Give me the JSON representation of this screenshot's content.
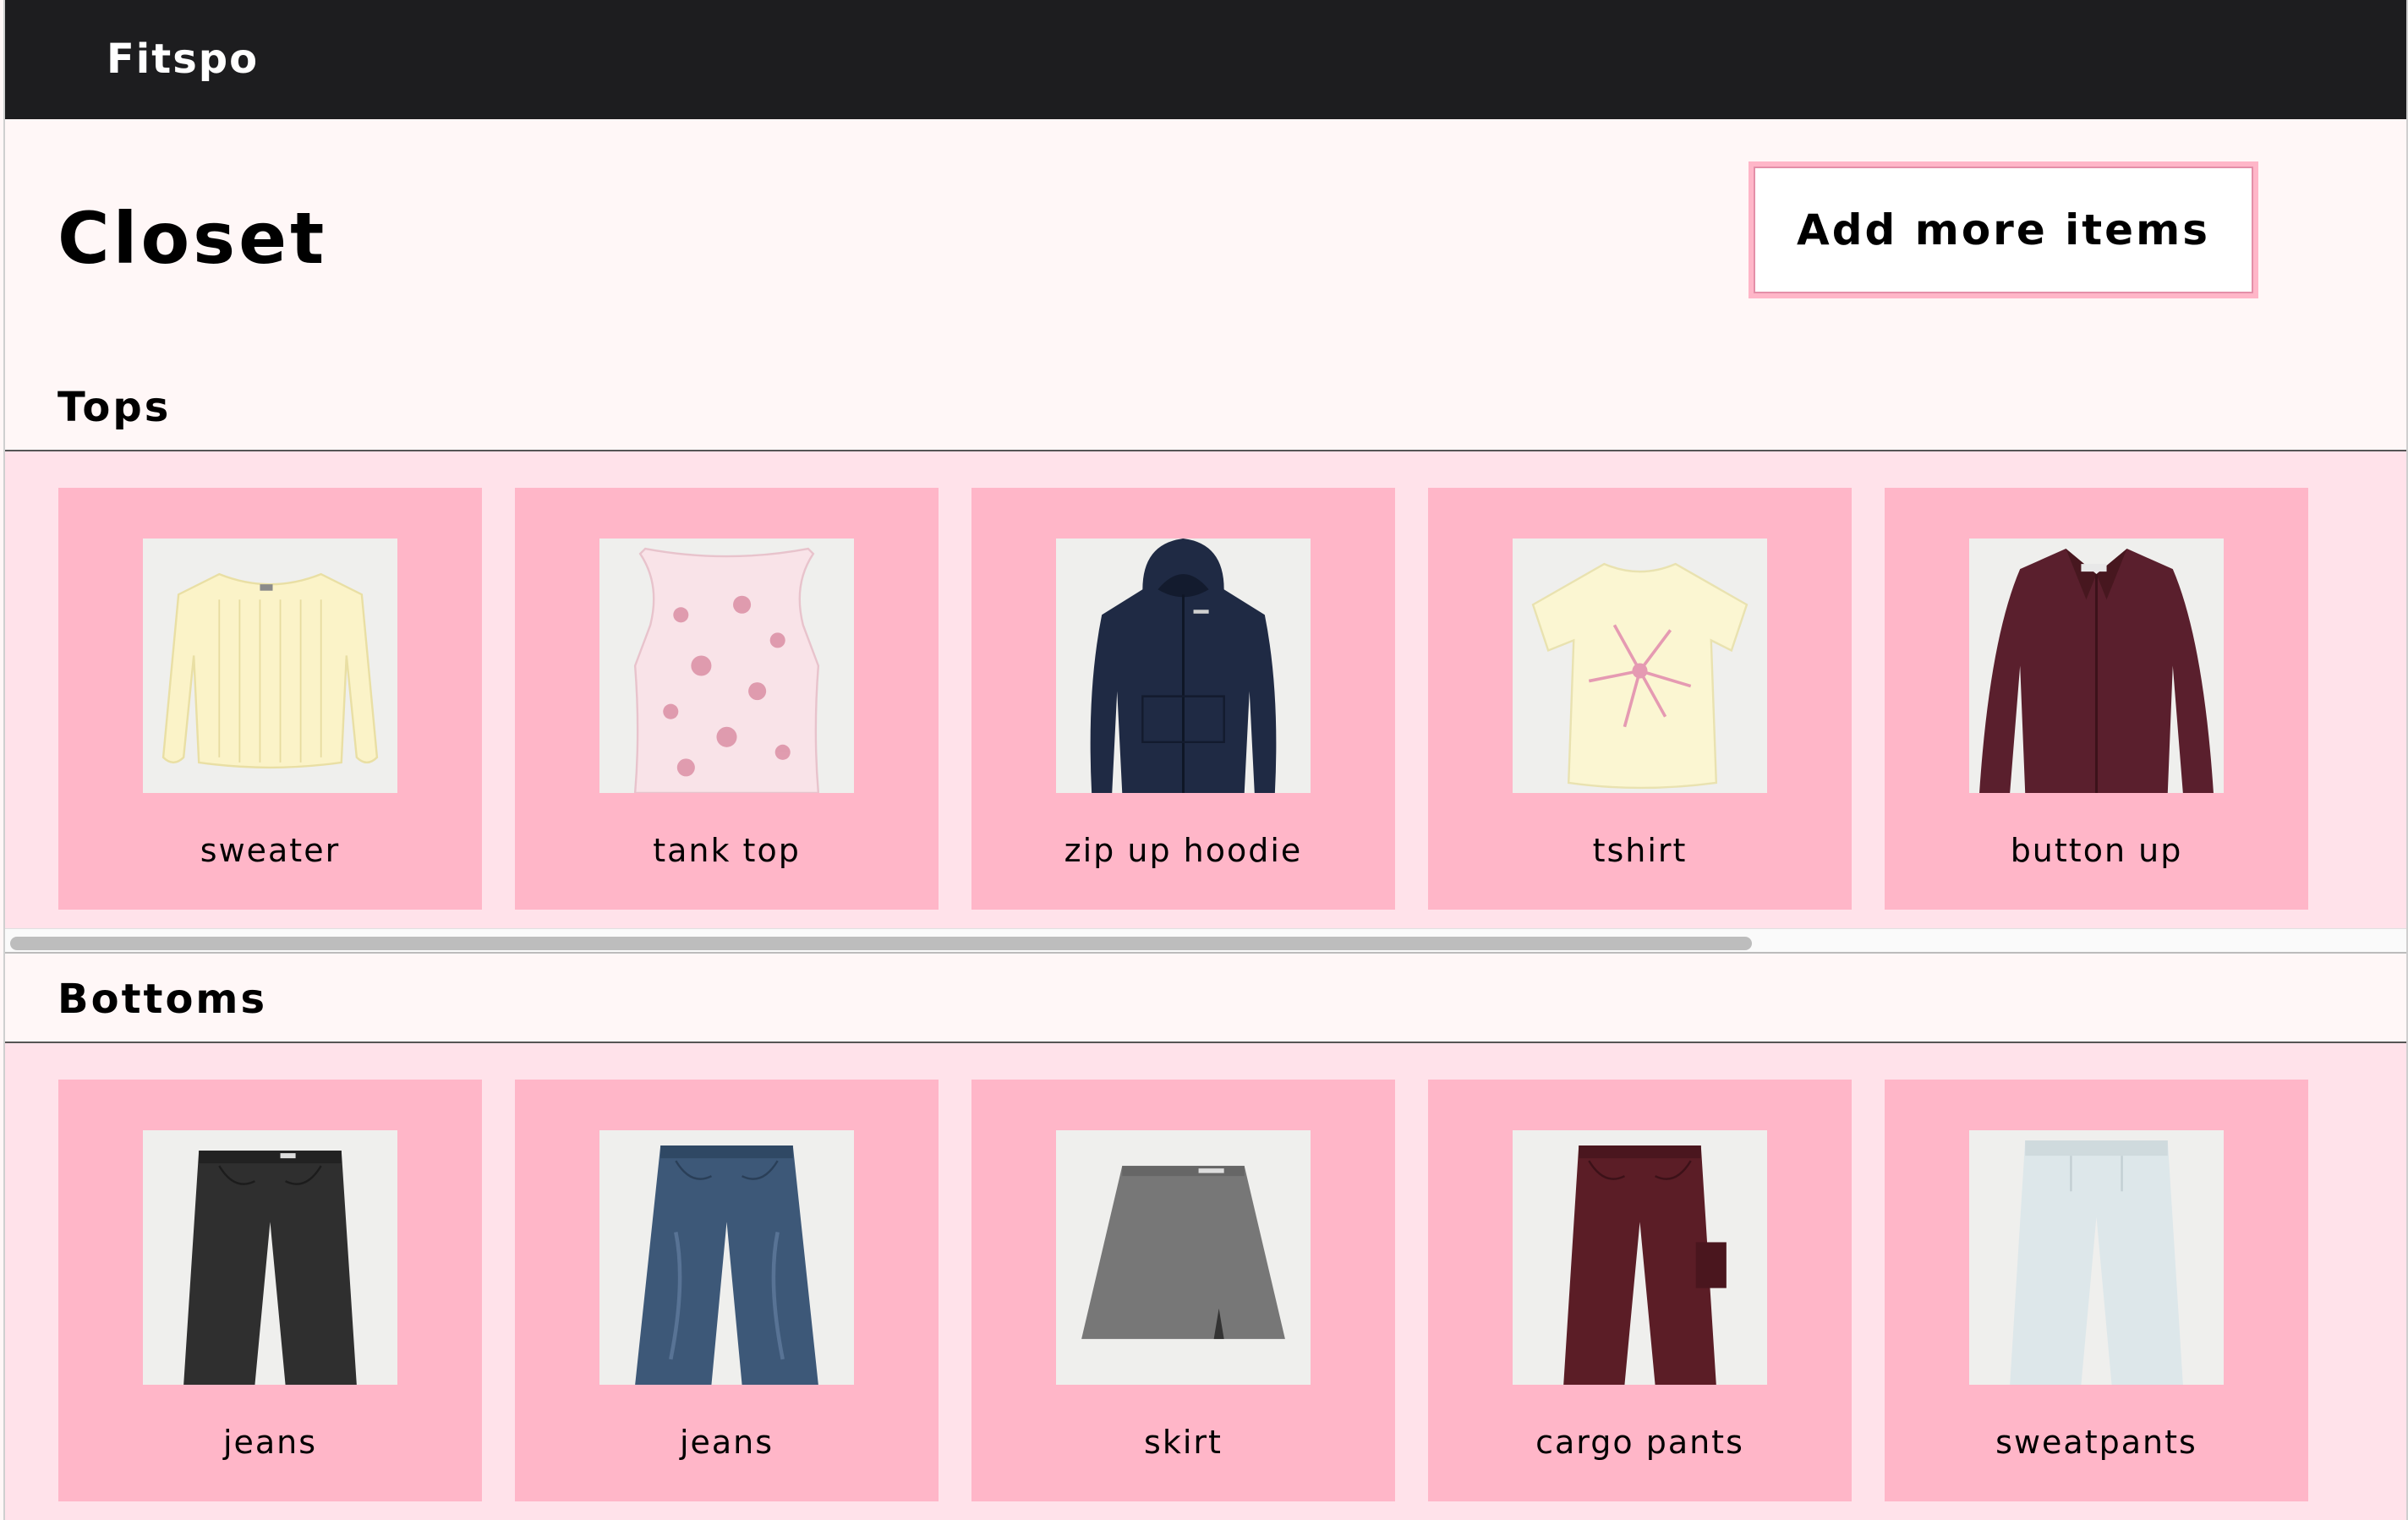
{
  "nav": {
    "brand": "Fitspo"
  },
  "page": {
    "title": "Closet",
    "add_button_label": "Add more items"
  },
  "colors": {
    "navbar": "#1d1d1f",
    "card": "#ffb6c8",
    "shelf": "#ffe2ea",
    "page": "#fff7f7"
  },
  "sections": [
    {
      "title": "Tops",
      "items": [
        {
          "label": "sweater",
          "icon": "sweater-photo"
        },
        {
          "label": "tank top",
          "icon": "tank-top-photo"
        },
        {
          "label": "zip up hoodie",
          "icon": "hoodie-photo"
        },
        {
          "label": "tshirt",
          "icon": "tshirt-photo"
        },
        {
          "label": "button up",
          "icon": "button-up-photo"
        }
      ]
    },
    {
      "title": "Bottoms",
      "items": [
        {
          "label": "jeans",
          "icon": "jeans-photo"
        },
        {
          "label": "jeans",
          "icon": "jeans-photo"
        },
        {
          "label": "skirt",
          "icon": "skirt-photo"
        },
        {
          "label": "cargo pants",
          "icon": "cargo-pants-photo"
        },
        {
          "label": "sweatpants",
          "icon": "sweatpants-photo"
        }
      ]
    }
  ]
}
